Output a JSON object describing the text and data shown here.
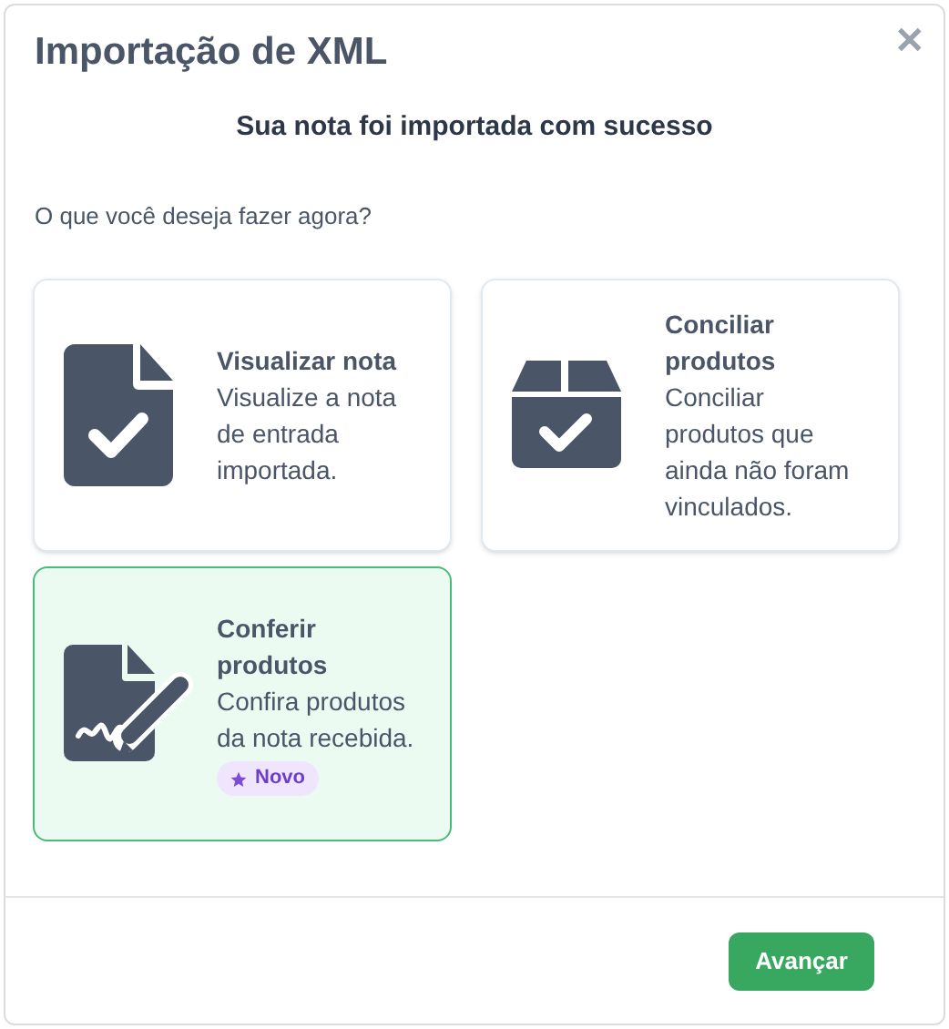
{
  "dialog": {
    "title": "Importação de XML",
    "close": "✕"
  },
  "heading": "Sua nota foi importada com sucesso",
  "question": "O que você deseja fazer agora?",
  "options": [
    {
      "kind": "document-check",
      "title": "Visualizar nota",
      "description": "Visualize a nota de entrada importada.",
      "selected": false
    },
    {
      "kind": "box-check",
      "title": "Conciliar produtos",
      "description": "Conciliar produtos que ainda não foram vinculados.",
      "selected": false
    },
    {
      "kind": "document-sign",
      "title": "Conferir produtos",
      "description": "Confira produtos da nota recebida.",
      "selected": true,
      "badge": "Novo"
    }
  ],
  "primary_button": "Avançar"
}
